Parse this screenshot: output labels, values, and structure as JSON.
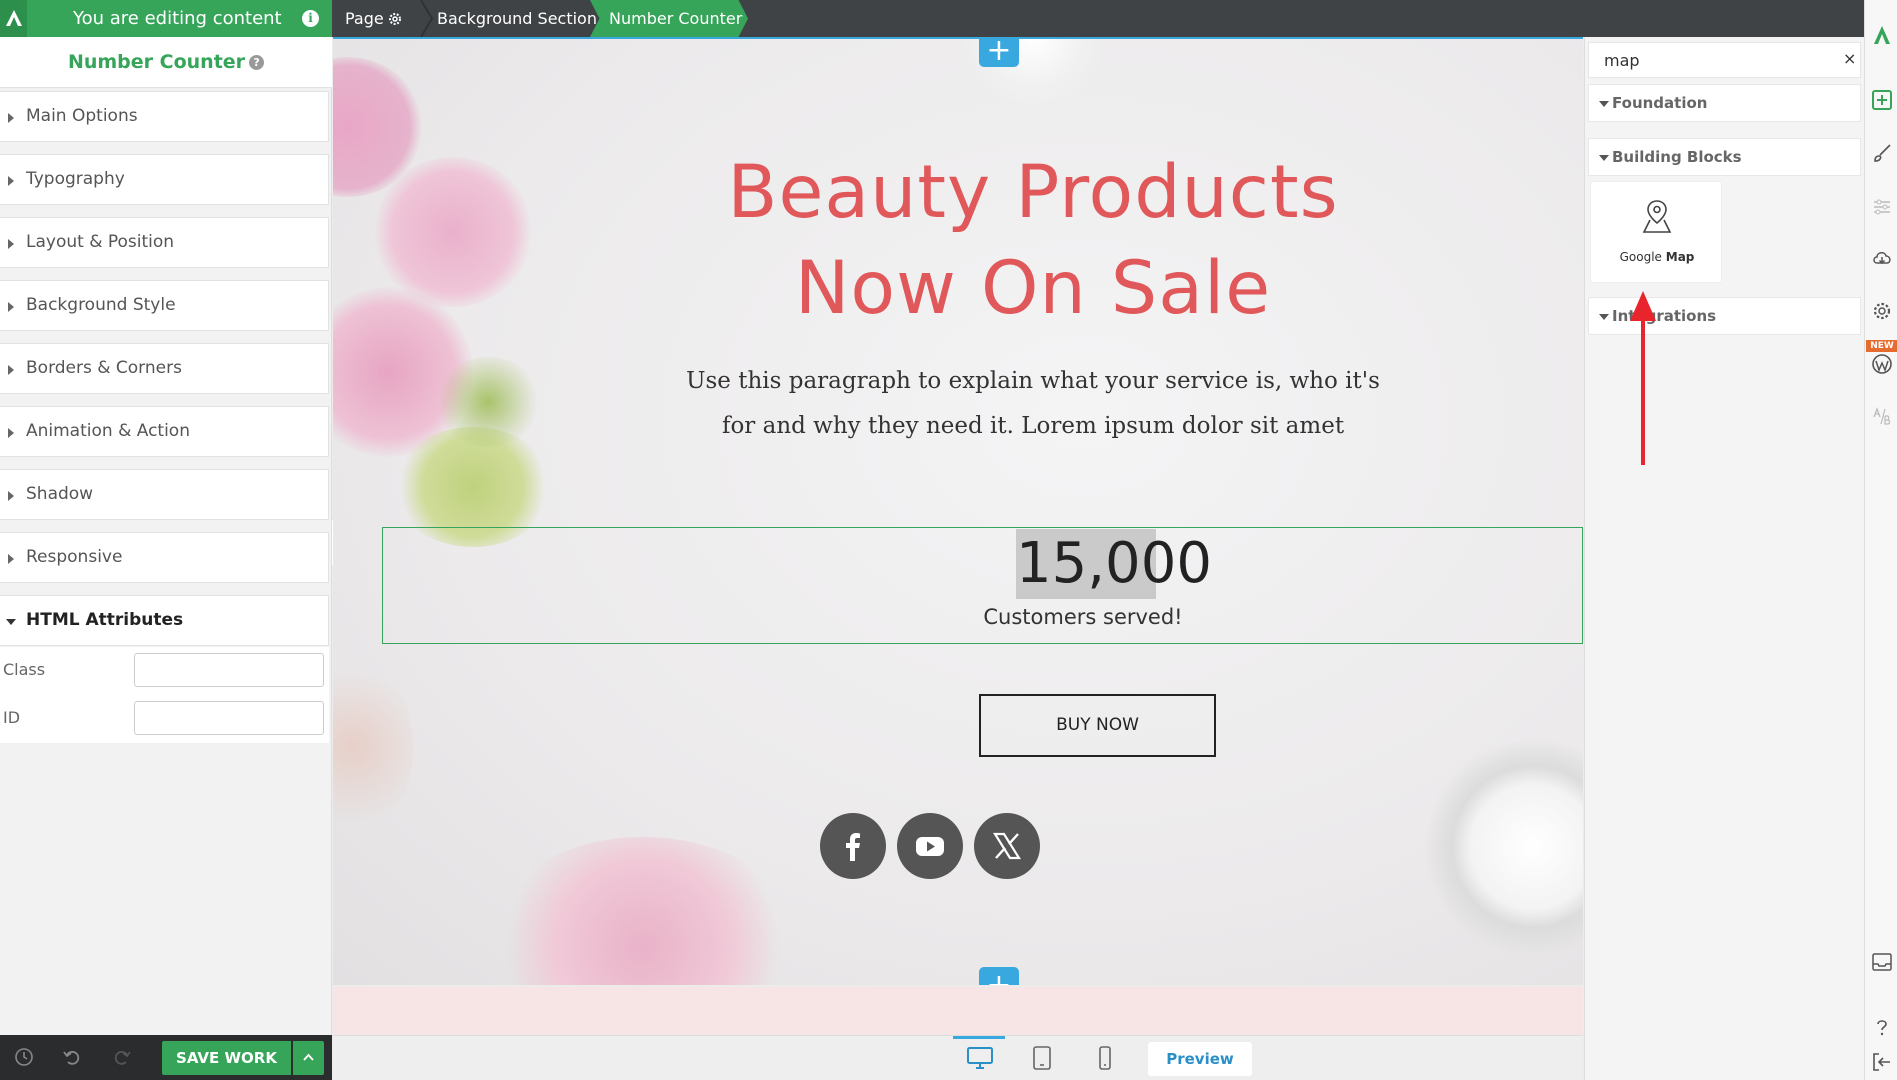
{
  "topbar": {
    "editing_label": "You are editing content",
    "breadcrumbs": [
      {
        "label": "Page"
      },
      {
        "label": "Background Section"
      },
      {
        "label": "Number Counter"
      }
    ]
  },
  "left_panel": {
    "title": "Number Counter",
    "sections": [
      {
        "label": "Main Options"
      },
      {
        "label": "Typography"
      },
      {
        "label": "Layout & Position"
      },
      {
        "label": "Background Style"
      },
      {
        "label": "Borders & Corners"
      },
      {
        "label": "Animation & Action"
      },
      {
        "label": "Shadow"
      },
      {
        "label": "Responsive"
      },
      {
        "label": "HTML Attributes"
      }
    ],
    "fields": [
      {
        "label": "Class",
        "value": ""
      },
      {
        "label": "ID",
        "value": ""
      }
    ],
    "save_label": "SAVE WORK"
  },
  "canvas": {
    "headline_line1": "Beauty Products",
    "headline_line2": "Now On Sale",
    "paragraph": "Use this paragraph to explain what your service is, who it's for and why they need it. Lorem ipsum dolor sit amet",
    "counter_value": "15,000",
    "counter_label": "Customers served!",
    "buy_button": "BUY NOW",
    "social_icons": [
      "facebook-icon",
      "youtube-icon",
      "x-icon"
    ]
  },
  "bottom_bar": {
    "devices": [
      "desktop-icon",
      "tablet-icon",
      "mobile-icon"
    ],
    "preview_label": "Preview"
  },
  "right_panel": {
    "search_value": "map",
    "clear_symbol": "×",
    "sections": [
      {
        "label": "Foundation"
      },
      {
        "label": "Building Blocks"
      },
      {
        "label": "Integrations"
      }
    ],
    "block": {
      "label_prefix": "Google ",
      "label_bold": "Map"
    }
  },
  "toolbar": {
    "new_badge": "NEW"
  },
  "colors": {
    "brand_green": "#36a55a",
    "accent_blue": "#39a8de",
    "headline_red": "#e0585a",
    "topbar": "#3f4346"
  }
}
